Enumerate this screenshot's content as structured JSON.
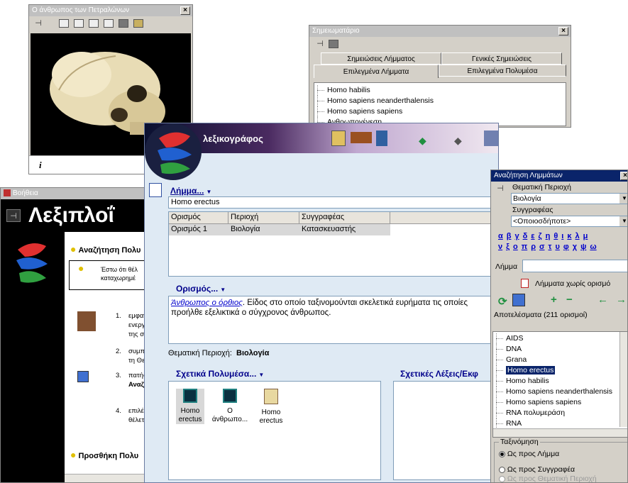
{
  "skull_window": {
    "title": "Ο άνθρωπος των Πετραλώνων",
    "info_icon": "i"
  },
  "notes_window": {
    "title": "Σημειωματάριο",
    "tabs_row1": [
      "Σημειώσεις Λήμματος",
      "Γενικές Σημειώσεις"
    ],
    "tabs_row2": [
      "Επιλεγμένα Λήμματα",
      "Επιλεγμένα Πολυμέσα"
    ],
    "items": [
      "Homo habilis",
      "Homo sapiens neanderthalensis",
      "Homo sapiens sapiens",
      "Ανθρωπογένεση"
    ]
  },
  "help_window": {
    "title": "Βοήθεια",
    "heading": "Λεξιπλοΐ",
    "section1": "Αναζήτηση Πολυ",
    "tip_text": [
      "Έστω ότι θέλ",
      "καταχωρημέ"
    ],
    "steps": [
      {
        "num": "1.",
        "lines": [
          "εμφαν",
          "ενεργ",
          "της σ"
        ]
      },
      {
        "num": "2.",
        "lines": [
          "συμπλ",
          "τη Θε"
        ]
      },
      {
        "num": "3.",
        "lines": [
          "πατήσ",
          "Αναζ"
        ]
      },
      {
        "num": "4.",
        "lines": [
          "επιλέγ",
          "θέλετ"
        ]
      }
    ],
    "section2": "Προσθήκη Πολυ"
  },
  "main_window": {
    "app_name": "λεξικογράφος",
    "lemma_label": "Λήμμα...",
    "lemma_value": "Homo erectus",
    "table_headers": [
      "Ορισμός",
      "Περιοχή",
      "Συγγραφέας"
    ],
    "table_rows": [
      [
        "Ορισμός 1",
        "Βιολογία",
        "Κατασκευαστής"
      ]
    ],
    "definition_label": "Ορισμός...",
    "definition_link": "Άνθρωπος ο όρθιος",
    "definition_text": ". Είδος στο οποίο ταξινομούνται σκελετικά ευρήματα τις οποίες προήλθε εξελικτικά ο σύγχρονος άνθρωπος.",
    "theme_label": "Θεματική Περιοχή:",
    "theme_value": "Βιολογία",
    "media_label": "Σχετικά Πολυμέσα...",
    "words_label": "Σχετικές Λέξεις/Εκφ",
    "media_items": [
      {
        "icon": "video-icon",
        "lines": [
          "Homo",
          "erectus"
        ]
      },
      {
        "icon": "video-icon",
        "lines": [
          "Ο",
          "άνθρωπο..."
        ]
      },
      {
        "icon": "document-icon",
        "lines": [
          "Homo",
          "erectus"
        ]
      }
    ]
  },
  "search_panel": {
    "title": "Αναζήτηση Λημμάτων",
    "theme_label": "Θεματική Περιοχή",
    "theme_value": "Βιολογία",
    "author_label": "Συγγραφέας",
    "author_value": "<Οποιοσδήποτε>",
    "greek_row1": [
      "α",
      "β",
      "γ",
      "δ",
      "ε",
      "ζ",
      "η",
      "θ",
      "ι",
      "κ",
      "λ",
      "μ"
    ],
    "greek_row2": [
      "ν",
      "ξ",
      "ο",
      "π",
      "ρ",
      "σ",
      "τ",
      "υ",
      "φ",
      "χ",
      "ψ",
      "ω"
    ],
    "lemma_label": "Λήμμα",
    "no_def_label": "Λήμματα χωρίς ορισμό",
    "results_label": "Αποτελέσματα (211 ορισμοί)",
    "results": [
      "AIDS",
      "DNA",
      "Grana",
      "Homo erectus",
      "Homo habilis",
      "Homo sapiens neanderthalensis",
      "Homo sapiens sapiens",
      "RNA πολυμεράση",
      "RNA"
    ],
    "selected_result": "Homo erectus",
    "sort_label": "Ταξινόμηση",
    "sort_options": [
      "Ως προς Λήμμα",
      "Ως προς Συγγραφέα",
      "Ως προς Θεματική Περιοχή"
    ]
  }
}
